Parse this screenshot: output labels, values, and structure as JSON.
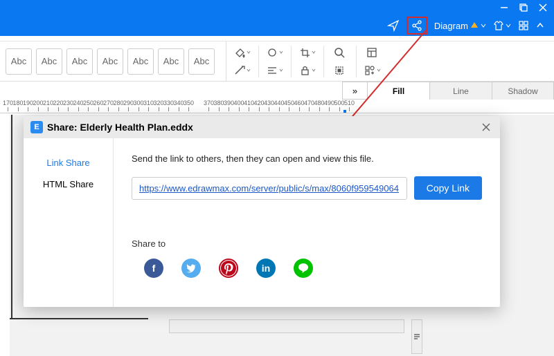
{
  "window_controls": {
    "minimize": "—",
    "maximize": "❐",
    "close": "✕"
  },
  "header": {
    "diagram_label": "Diagram",
    "style_btns": [
      {
        "name": "abc-1",
        "label": "Abc"
      },
      {
        "name": "abc-2",
        "label": "Abc"
      },
      {
        "name": "abc-3",
        "label": "Abc"
      },
      {
        "name": "abc-4",
        "label": "Abc"
      },
      {
        "name": "abc-5",
        "label": "Abc"
      },
      {
        "name": "abc-6",
        "label": "Abc"
      },
      {
        "name": "abc-7",
        "label": "Abc"
      }
    ]
  },
  "right_tabs": {
    "expand": "»",
    "fill": "Fill",
    "line": "Line",
    "shadow": "Shadow"
  },
  "ruler": [
    170,
    180,
    190,
    200,
    210,
    220,
    230,
    240,
    250,
    260,
    270,
    280,
    290,
    300,
    310,
    320,
    330,
    340,
    350,
    370,
    380,
    390,
    400,
    410,
    420,
    430,
    440,
    450,
    460,
    470,
    480,
    490,
    500,
    510
  ],
  "dialog": {
    "title": "Share: Elderly Health Plan.eddx",
    "logo_letter": "E",
    "sidebar": {
      "link_share": "Link Share",
      "html_share": "HTML Share"
    },
    "instruction": "Send the link to others, then they can open and view this file.",
    "link_url": "https://www.edrawmax.com/server/public/s/max/8060f959549064",
    "copy_label": "Copy Link",
    "share_to": "Share to",
    "social": {
      "facebook": "f",
      "twitter": "t",
      "pinterest": "P",
      "linkedin": "in",
      "line": "L"
    }
  }
}
